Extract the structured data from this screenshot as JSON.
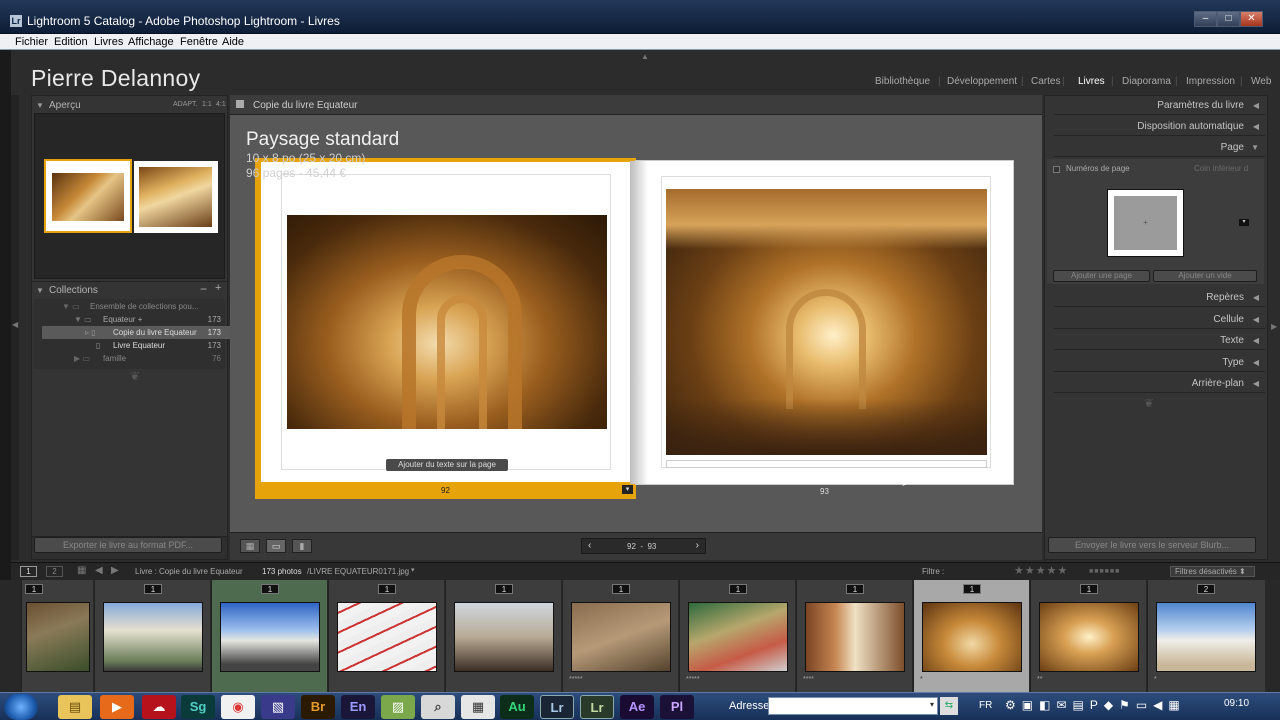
{
  "window": {
    "title": "Lightroom 5 Catalog - Adobe Photoshop Lightroom - Livres",
    "icon": "Lr"
  },
  "menu": [
    "Fichier",
    "Edition",
    "Livres",
    "Affichage",
    "Fenêtre",
    "Aide"
  ],
  "identity_plate": "Pierre Delannoy",
  "modules": [
    "Bibliothèque",
    "Développement",
    "Cartes",
    "Livres",
    "Diaporama",
    "Impression",
    "Web"
  ],
  "left_panel": {
    "apercu": {
      "title": "Aperçu",
      "controls": [
        "ADAPT.",
        "1:1",
        "4:1"
      ]
    },
    "collections": {
      "title": "Collections",
      "minus": "−",
      "plus": "+",
      "items": [
        {
          "label": "Ensemble de collections pou...",
          "count": ""
        },
        {
          "label": "Equateur +",
          "count": "173"
        },
        {
          "label": "Copie du livre Equateur",
          "count": "173"
        },
        {
          "label": "Livre Equateur",
          "count": "173"
        },
        {
          "label": "famille",
          "count": "76"
        }
      ]
    },
    "export_button": "Exporter le livre au format PDF..."
  },
  "center": {
    "header": "Copie du livre Equateur",
    "book_title": "Paysage standard",
    "book_size": "10 x 8 po (25 x 20 cm)",
    "book_info": "96 pages - 45,44 €",
    "add_text": "Ajouter du texte sur la page",
    "page_left": "92",
    "page_right": "93",
    "pager": "92  -  93"
  },
  "right_panel": {
    "headers": [
      "Paramètres du livre",
      "Disposition automatique",
      "Page"
    ],
    "page_numbers_label": "Numéros de page",
    "page_numbers_value": "Coin inférieur d",
    "add_page": "Ajouter une page",
    "add_blank": "Ajouter un vide",
    "sections": [
      "Repères",
      "Cellule",
      "Texte",
      "Type",
      "Arrière-plan"
    ],
    "send_button": "Envoyer le livre vers le serveur Blurb..."
  },
  "filmstrip_bar": {
    "source": "Livre : Copie du livre Equateur",
    "count": "173 photos",
    "file": "/LIVRE EQUATEUR0171.jpg",
    "filter_label": "Filtre :",
    "filter_value": "Filtres désactivés",
    "monitors": [
      "1",
      "2"
    ]
  },
  "filmstrip": {
    "badges": [
      "1",
      "1",
      "1",
      "1",
      "1",
      "1",
      "1",
      "1",
      "1",
      "1",
      "2"
    ],
    "stars": [
      "",
      "",
      "",
      "",
      "",
      "*****",
      "*****",
      "****",
      "*",
      "**",
      "*"
    ]
  },
  "taskbar": {
    "address_label": "Adresse",
    "lang": "FR",
    "time": "09:10",
    "apps": [
      "Sg",
      "Br",
      "En",
      "Au",
      "Lr",
      "Lr",
      "Ae",
      "Pl"
    ]
  },
  "colors": {
    "accent": "#e7a30a",
    "window_title": "#1a2f50",
    "panel": "#3a3a3a"
  }
}
